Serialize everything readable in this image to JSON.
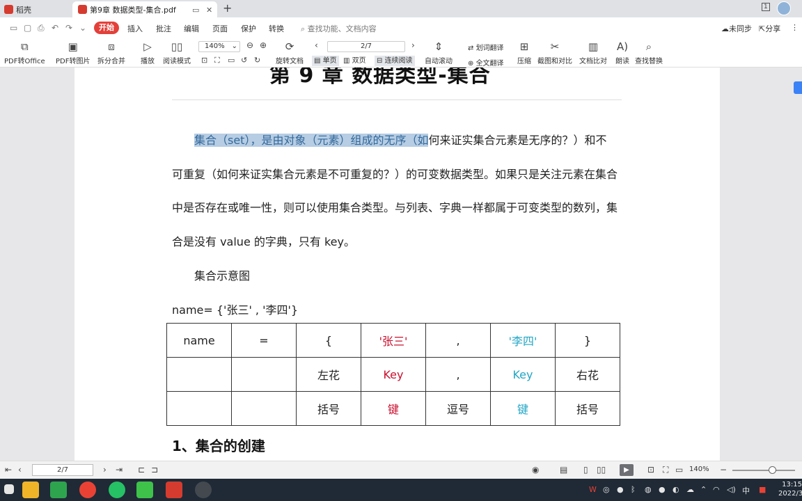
{
  "titlebar": {
    "home_tab": "稻壳",
    "doc_tab": "第9章 数据类型-集合.pdf",
    "new_tab": "+"
  },
  "menubar": {
    "items": [
      "开始",
      "插入",
      "批注",
      "编辑",
      "页面",
      "保护",
      "转换"
    ],
    "search_placeholder": "查找功能、文档内容",
    "sync": "未同步",
    "share": "分享"
  },
  "toolbar": {
    "pdf_to_office": "PDF转Office",
    "pdf_to_image": "PDF转图片",
    "split_merge": "拆分合并",
    "play": "播放",
    "read_mode": "阅读模式",
    "zoom_value": "140%",
    "rotate_doc": "旋转文档",
    "page_value": "2/7",
    "single_page": "单页",
    "double_page": "双页",
    "continuous": "连续阅读",
    "auto_scroll": "自动滚动",
    "word_translate": "划词翻译",
    "full_translate": "全文翻译",
    "compress": "压缩",
    "screenshot_compare": "截图和对比",
    "doc_compare": "文档比对",
    "read_aloud": "朗读",
    "find_replace": "查找替换"
  },
  "document": {
    "chapter_title": "第 9 章  数据类型-集合",
    "para_lines": [
      {
        "highlight": "集合（set），是由对象（元素）组成的无序（如",
        "rest": "何来证实集合元素是无序的？）和不"
      },
      {
        "highlight": "",
        "rest": "可重复（如何来证实集合元素是不可重复的？）的可变数据类型。如果只是关注元素在集合"
      },
      {
        "highlight": "",
        "rest": "中是否存在或唯一性，则可以使用集合类型。与列表、字典一样都属于可变类型的数列，集"
      },
      {
        "highlight": "",
        "rest": "合是没有 value 的字典，只有 key。"
      }
    ],
    "fig_caption": "集合示意图",
    "code_line": "name= {'张三' , '李四'}",
    "table": {
      "row1": [
        "name",
        "=",
        "{",
        "'张三'",
        ",",
        "'李四'",
        "}"
      ],
      "row2": [
        "",
        "",
        "左花",
        "Key",
        ",",
        "Key",
        "右花"
      ],
      "row3": [
        "",
        "",
        "括号",
        "键",
        "逗号",
        "键",
        "括号"
      ]
    },
    "section_heading": "1、集合的创建"
  },
  "statusbar": {
    "page_value": "2/7",
    "zoom": "140%"
  },
  "taskbar": {
    "ime": "中",
    "clock_time": "13:15",
    "clock_date": "2022/3"
  },
  "colors": {
    "accent_red": "#e3403a",
    "highlight": "#b6cde4",
    "key_red": "#c8102e",
    "key_cyan": "#22a6c4"
  }
}
